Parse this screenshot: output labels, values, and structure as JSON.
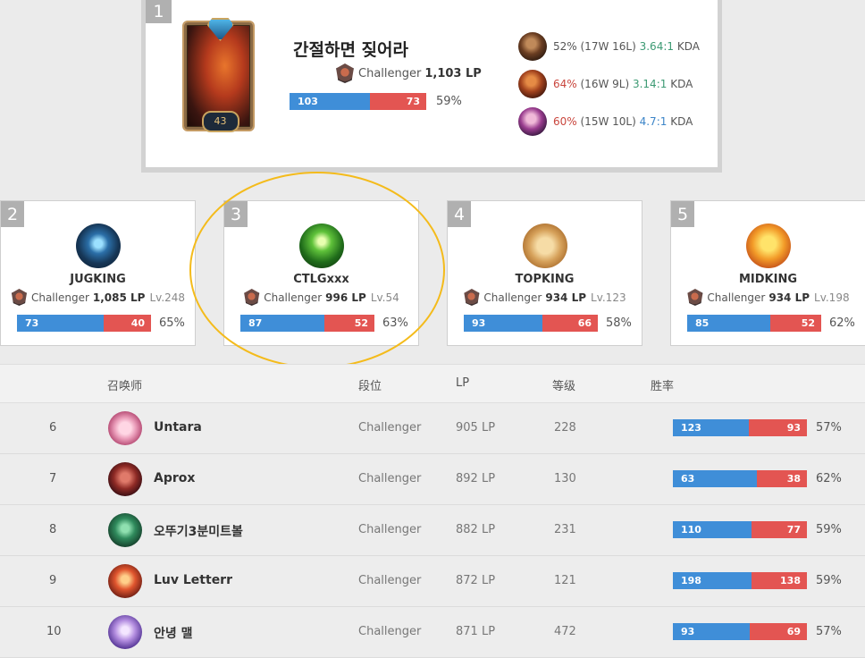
{
  "top_player": {
    "rank": "1",
    "name": "간절하면 짖어라",
    "tier": "Challenger",
    "lp": "1,103 LP",
    "level": "43",
    "wins": "103",
    "losses": "73",
    "win_fraction": 0.585,
    "winrate": "59%",
    "champions": [
      {
        "icon": "champion-portrait-icon",
        "winrate": "52%",
        "record": "(17W 16L)",
        "kda": "3.64:1",
        "kda_suffix": "KDA",
        "winrate_color": "#555555",
        "kda_color": "#3c9a73"
      },
      {
        "icon": "champion-portrait-icon",
        "winrate": "64%",
        "record": "(16W 9L)",
        "kda": "3.14:1",
        "kda_suffix": "KDA",
        "winrate_color": "#c9463d",
        "kda_color": "#3c9a73"
      },
      {
        "icon": "champion-portrait-icon",
        "winrate": "60%",
        "record": "(15W 10L)",
        "kda": "4.7:1",
        "kda_suffix": "KDA",
        "winrate_color": "#c9463d",
        "kda_color": "#3c85c8"
      }
    ]
  },
  "cards": [
    {
      "rank": "2",
      "name": "JUGKING",
      "tier": "Challenger",
      "lp": "1,085 LP",
      "level": "Lv.248",
      "wins": "73",
      "losses": "40",
      "win_fraction": 0.646,
      "winrate": "65%"
    },
    {
      "rank": "3",
      "name": "CTLGxxx",
      "tier": "Challenger",
      "lp": "996 LP",
      "level": "Lv.54",
      "wins": "87",
      "losses": "52",
      "win_fraction": 0.626,
      "winrate": "63%"
    },
    {
      "rank": "4",
      "name": "TOPKING",
      "tier": "Challenger",
      "lp": "934 LP",
      "level": "Lv.123",
      "wins": "93",
      "losses": "66",
      "win_fraction": 0.585,
      "winrate": "58%"
    },
    {
      "rank": "5",
      "name": "MIDKING",
      "tier": "Challenger",
      "lp": "934 LP",
      "level": "Lv.198",
      "wins": "85",
      "losses": "52",
      "win_fraction": 0.62,
      "winrate": "62%"
    }
  ],
  "table": {
    "headers": {
      "summoner": "召唤师",
      "tier": "段位",
      "lp": "LP",
      "level": "等级",
      "winrate": "胜率"
    },
    "rows": [
      {
        "rank": "6",
        "name": "Untara",
        "tier": "Challenger",
        "lp": "905 LP",
        "level": "228",
        "wins": "123",
        "losses": "93",
        "win_fraction": 0.569,
        "winrate": "57%"
      },
      {
        "rank": "7",
        "name": "Aprox",
        "tier": "Challenger",
        "lp": "892 LP",
        "level": "130",
        "wins": "63",
        "losses": "38",
        "win_fraction": 0.624,
        "winrate": "62%"
      },
      {
        "rank": "8",
        "name": "오뚜기3분미트볼",
        "tier": "Challenger",
        "lp": "882 LP",
        "level": "231",
        "wins": "110",
        "losses": "77",
        "win_fraction": 0.588,
        "winrate": "59%"
      },
      {
        "rank": "9",
        "name": "Luv Letterr",
        "tier": "Challenger",
        "lp": "872 LP",
        "level": "121",
        "wins": "198",
        "losses": "138",
        "win_fraction": 0.589,
        "winrate": "59%"
      },
      {
        "rank": "10",
        "name": "안녕 맬",
        "tier": "Challenger",
        "lp": "871 LP",
        "level": "472",
        "wins": "93",
        "losses": "69",
        "win_fraction": 0.574,
        "winrate": "57%"
      }
    ]
  },
  "colors": {
    "win": "#3f8ed8",
    "loss": "#e35552",
    "highlight": "#f4bb1b"
  }
}
